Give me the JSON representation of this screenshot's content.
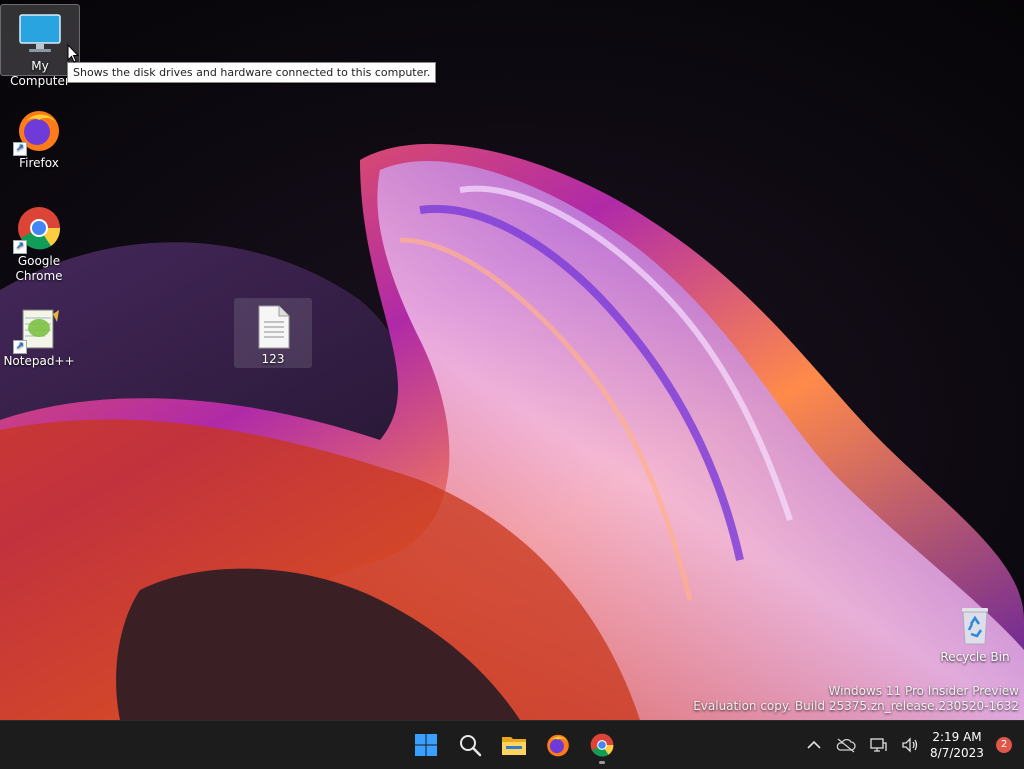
{
  "desktop": {
    "icons": [
      {
        "label": "My Computer",
        "icon": "monitor-icon"
      },
      {
        "label": "Firefox",
        "icon": "firefox-icon"
      },
      {
        "label": "Google Chrome",
        "icon": "chrome-icon"
      },
      {
        "label": "Notepad++",
        "icon": "notepadpp-icon"
      },
      {
        "label": "123",
        "icon": "text-file-icon"
      },
      {
        "label": "Recycle Bin",
        "icon": "recycle-bin-icon"
      }
    ],
    "tooltip": "Shows the disk drives and hardware connected to this computer.",
    "watermark": {
      "line1": "Windows 11 Pro Insider Preview",
      "line2": "Evaluation copy. Build 25375.zn_release.230520-1632"
    }
  },
  "taskbar": {
    "apps": [
      "start-icon",
      "search-icon",
      "file-explorer-icon",
      "firefox-icon",
      "chrome-icon"
    ],
    "clock": {
      "time": "2:19 AM",
      "date": "8/7/2023"
    },
    "notification_count": "2"
  },
  "colors": {
    "taskbar": "#1c1c1c",
    "accent": "#0078d4",
    "badge": "#e0584a"
  }
}
